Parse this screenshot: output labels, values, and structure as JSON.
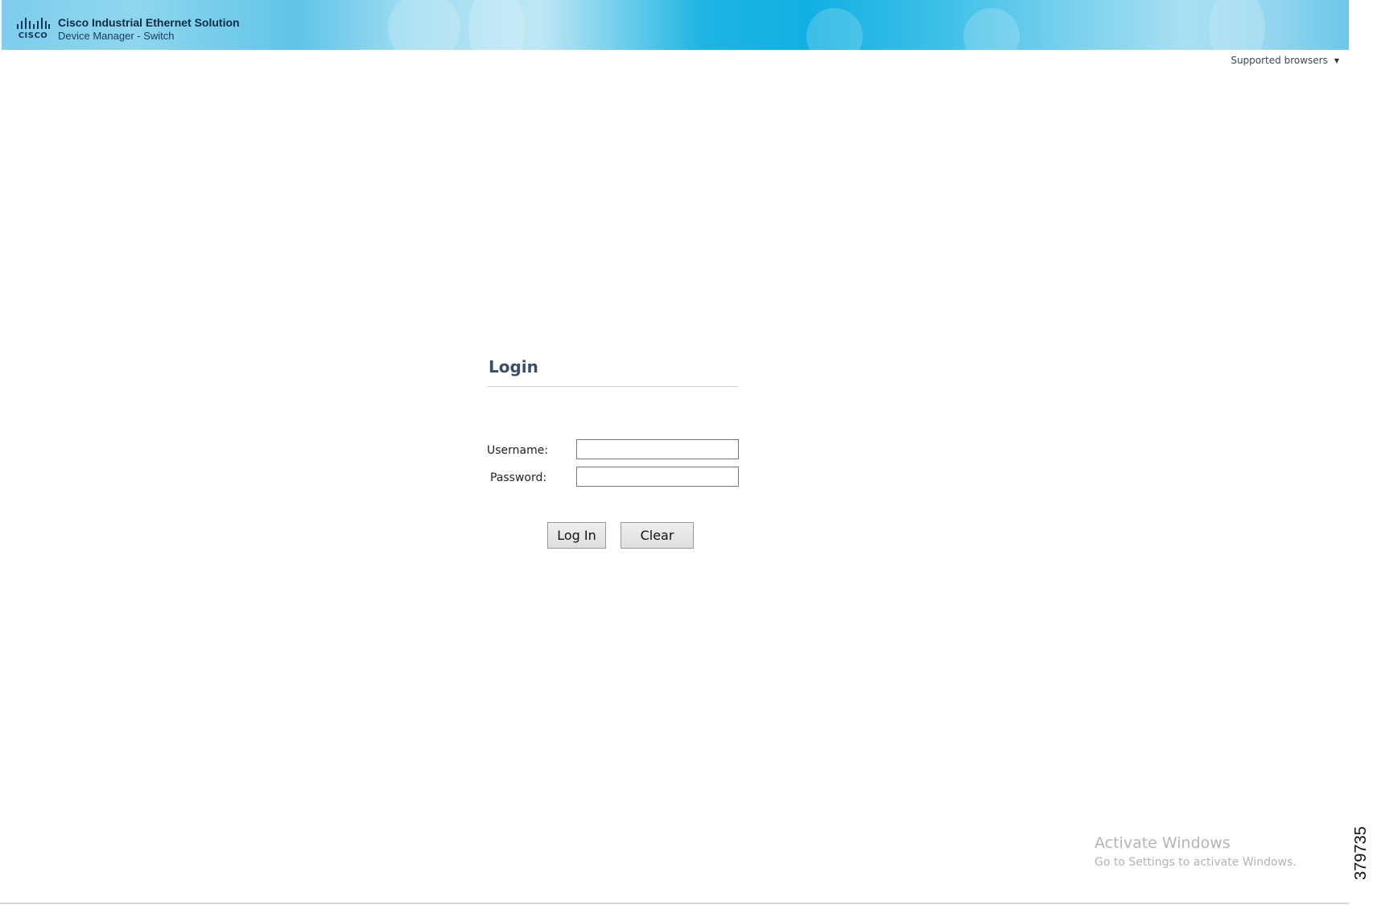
{
  "header": {
    "logo_word": "CISCO",
    "title": "Cisco Industrial Ethernet Solution",
    "subtitle": "Device Manager - Switch"
  },
  "supported_browsers": {
    "label": "Supported browsers",
    "icon": "caret-down-icon"
  },
  "login": {
    "title": "Login",
    "username_label": "Username:",
    "username_value": "",
    "password_label": "Password:",
    "password_value": "",
    "login_button": "Log In",
    "clear_button": "Clear"
  },
  "watermark": {
    "title": "Activate Windows",
    "subtitle": "Go to Settings to activate Windows."
  },
  "figure_number": "379735",
  "colors": {
    "header_accent": "#1eb5e3",
    "login_title": "#3b4f6b"
  }
}
